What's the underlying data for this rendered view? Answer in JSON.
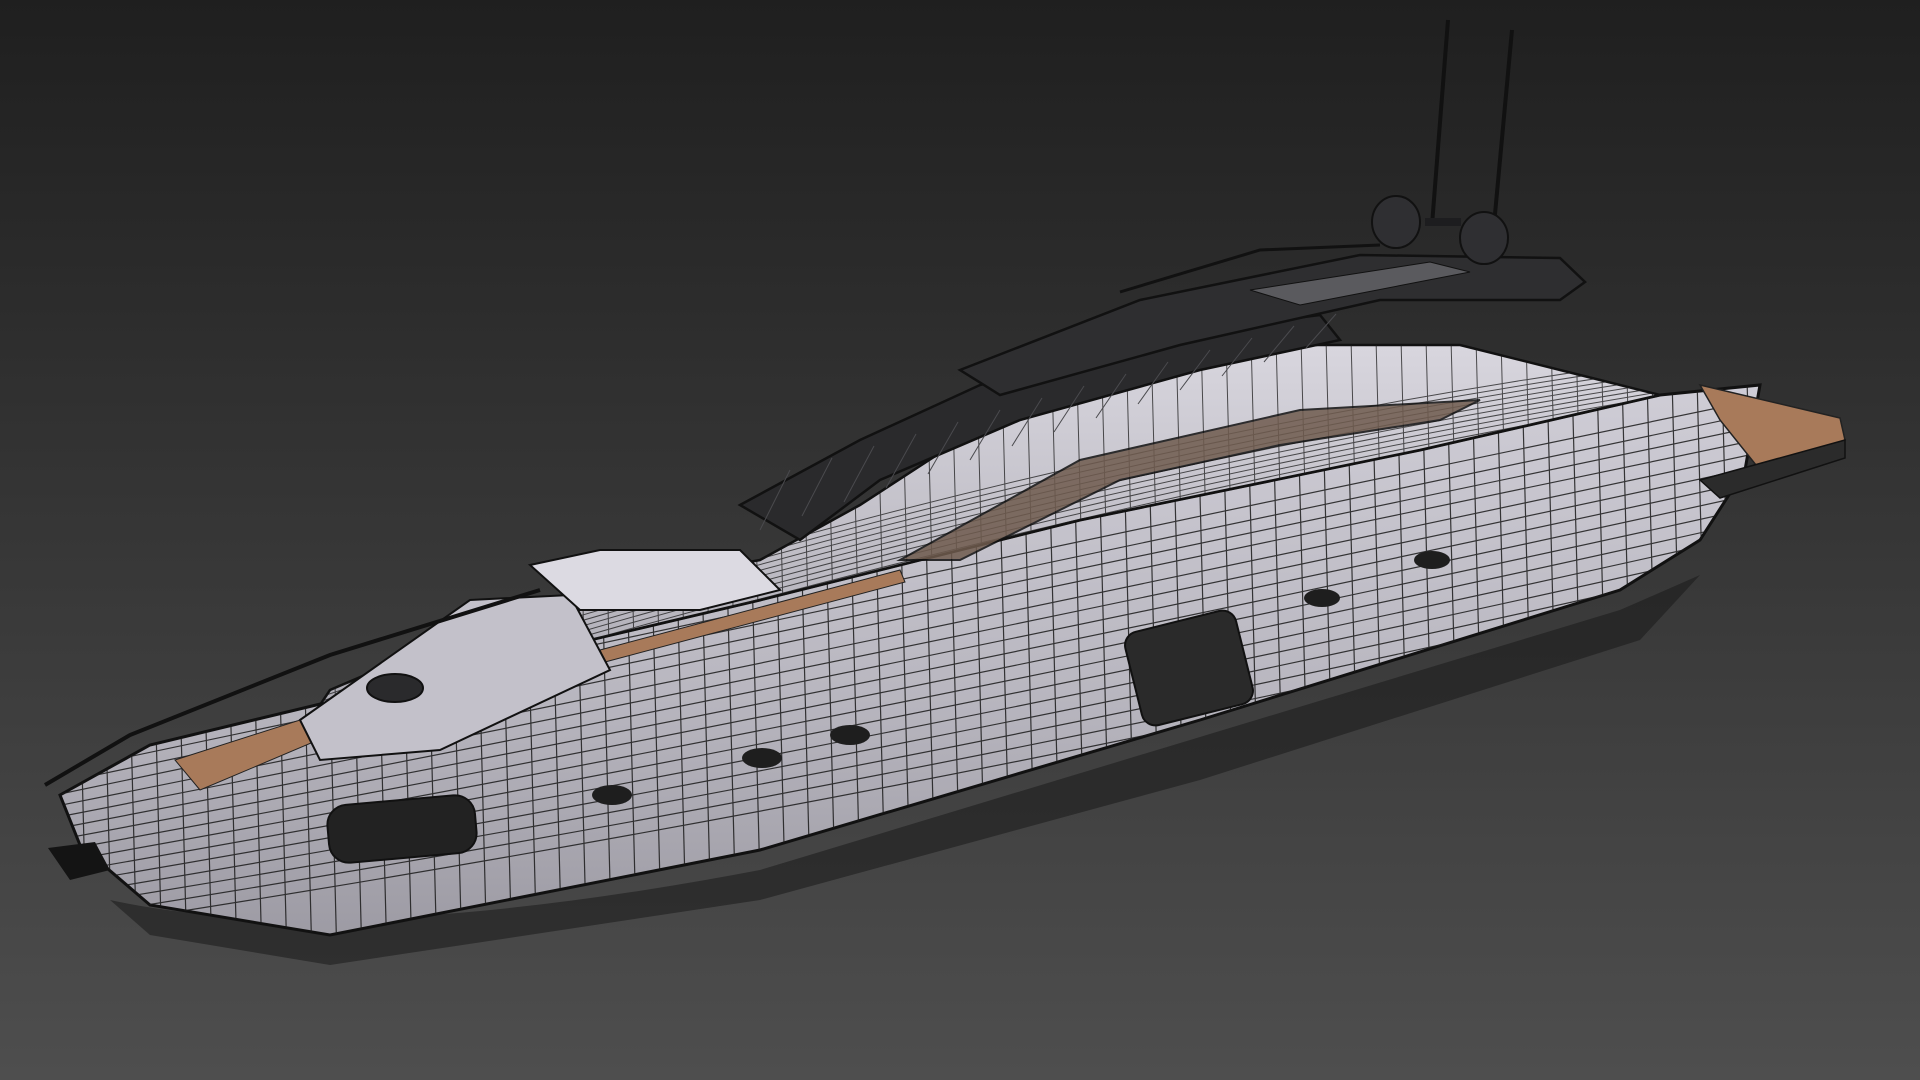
{
  "viewport": {
    "render_mode": "shaded-wireframe",
    "subject": "motor-yacht-3d-model"
  },
  "colors": {
    "background_top": "#1f1f1f",
    "background_bottom": "#4e4e4e",
    "hull": "#bfbdc6",
    "hull_dark": "#8f8d96",
    "wire": "#1b1b1b",
    "glass": "#2a2a2c",
    "teak": "#a87a5a",
    "shadow": "#1a1a1a"
  }
}
